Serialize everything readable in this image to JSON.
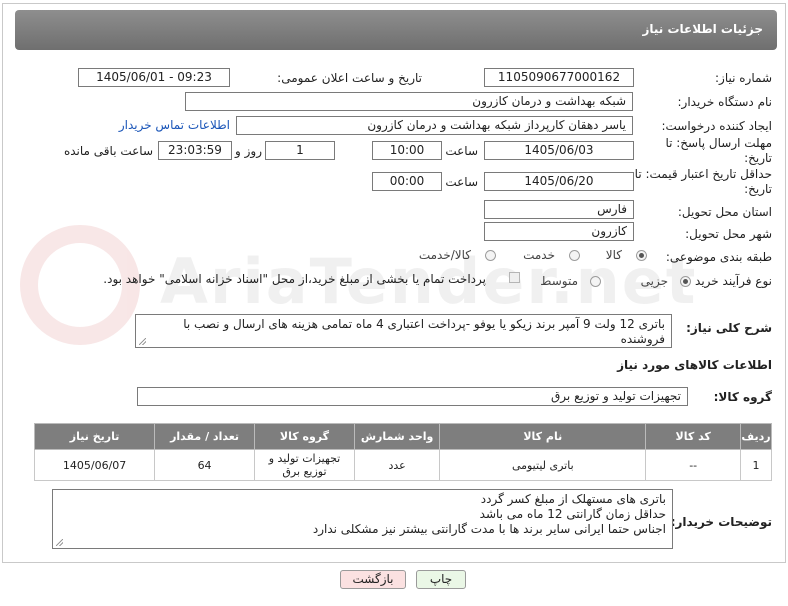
{
  "header": {
    "title": "جزئیات اطلاعات نیاز"
  },
  "watermark": {
    "text": "AriaTender.net"
  },
  "form": {
    "need_number": {
      "label": "شماره نیاز:",
      "value": "1105090677000162"
    },
    "announce_datetime": {
      "label": "تاریخ و ساعت اعلان عمومی:",
      "value": "1405/06/01 - 09:23"
    },
    "buyer_org": {
      "label": "نام دستگاه خریدار:",
      "value": "شبکه بهداشت و درمان کازرون"
    },
    "requester": {
      "label": "ایجاد کننده درخواست:",
      "value": "یاسر دهقان کارپرداز شبکه بهداشت و درمان کازرون",
      "contact_link": "اطلاعات تماس خریدار"
    },
    "reply_deadline": {
      "label": "مهلت ارسال پاسخ: تا تاریخ:",
      "date": "1405/06/03",
      "time_label": "ساعت",
      "time": "10:00",
      "days": "1",
      "days_label": "روز و",
      "remaining": "23:03:59",
      "remaining_label": "ساعت باقی مانده"
    },
    "price_validity": {
      "label": "حداقل تاریخ اعتبار قیمت: تا تاریخ:",
      "date": "1405/06/20",
      "time_label": "ساعت",
      "time": "00:00"
    },
    "province": {
      "label": "استان محل تحویل:",
      "value": "فارس"
    },
    "city": {
      "label": "شهر محل تحویل:",
      "value": "کازرون"
    },
    "category": {
      "label": "طبقه بندی موضوعی:",
      "options": [
        "کالا",
        "خدمت",
        "کالا/خدمت"
      ],
      "selected": "کالا"
    },
    "process_type": {
      "label": "نوع فرآیند خرید :",
      "options": [
        "جزیی",
        "متوسط"
      ],
      "selected": "جزیی",
      "payment_note": "پرداخت تمام یا بخشی از مبلغ خرید،از محل \"اسناد خزانه اسلامی\" خواهد بود."
    }
  },
  "description": {
    "label": "شرح کلی نیاز:",
    "value": "باتری 12 ولت 9 آمپر برند  زیکو یا یوفو -پرداخت اعتباری 4 ماه تمامی هزینه های ارسال و نصب با فروشنده"
  },
  "goods_info": {
    "section_title": "اطلاعات کالاهای مورد نیاز",
    "group_label": "گروه کالا:",
    "group_value": "تجهیزات تولید و توزیع برق"
  },
  "items_table": {
    "headers": [
      "ردیف",
      "کد کالا",
      "نام کالا",
      "واحد شمارش",
      "گروه کالا",
      "تعداد / مقدار",
      "تاریخ نیاز"
    ],
    "rows": [
      [
        "1",
        "--",
        "باتری لیتیومی",
        "عدد",
        "تجهیزات تولید و توزیع برق",
        "64",
        "1405/06/07"
      ]
    ]
  },
  "buyer_notes": {
    "label": "توضیحات خریدار:",
    "lines": [
      "باتری های مستهلک  از مبلغ کسر گردد",
      "حداقل زمان گارانتی 12 ماه می باشد",
      "اجناس حتما ایرانی  سایر برند ها با مدت گارانتی بیشتر نیز مشکلی ندارد"
    ]
  },
  "buttons": {
    "print": "چاپ",
    "back": "بازگشت"
  },
  "colors": {
    "header_bg": "#7e7e7e",
    "link": "#1a55b8",
    "print_btn": "#eaf7e6",
    "back_btn": "#fbe1e1"
  }
}
